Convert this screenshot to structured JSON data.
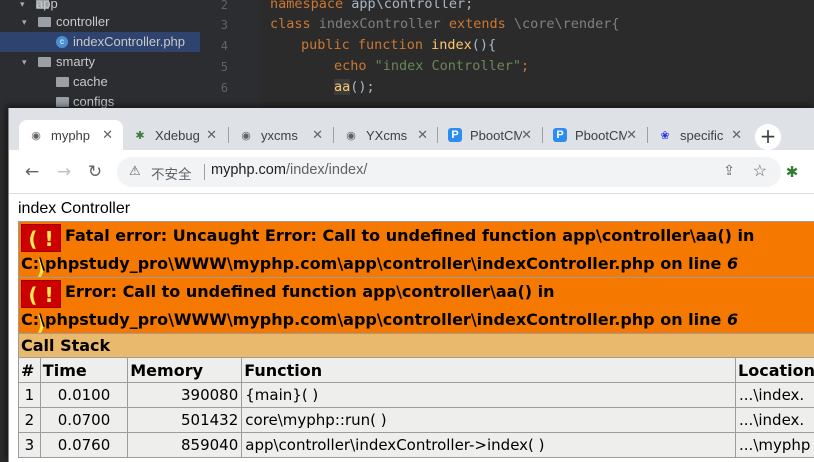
{
  "ide": {
    "tree": [
      {
        "label": "app",
        "kind": "folder",
        "indent": 1,
        "arrow": "▾"
      },
      {
        "label": "controller",
        "kind": "folder",
        "indent": 2,
        "arrow": "▾"
      },
      {
        "label": "indexController.php",
        "kind": "php",
        "indent": 3,
        "arrow": "",
        "selected": true
      },
      {
        "label": "smarty",
        "kind": "folder",
        "indent": 2,
        "arrow": "▾"
      },
      {
        "label": "cache",
        "kind": "folder",
        "indent": 3,
        "arrow": ""
      },
      {
        "label": "configs",
        "kind": "folder",
        "indent": 3,
        "arrow": ""
      }
    ],
    "line_numbers": [
      "2",
      "3",
      "4",
      "5",
      "6"
    ],
    "code": {
      "line2_kw": "namespace",
      "line2_rest": " app\\controller;",
      "line3_kw1": "class",
      "line3_name": " indexController ",
      "line3_kw2": "extends",
      "line3_rest": " \\core\\render{",
      "line4_kw1": "public",
      "line4_kw2": "function",
      "line4_fn": "index",
      "line4_rest": "(){",
      "line5_kw": "echo",
      "line5_str": "\"index Controller\"",
      "line5_end": ";",
      "line6_fn": "aa",
      "line6_rest": "();"
    }
  },
  "browser": {
    "tabs": [
      {
        "label": "myphp",
        "icon": "globe-icon",
        "glyph": "◉",
        "active": true
      },
      {
        "label": "Xdebug",
        "icon": "xdebug-icon",
        "glyph": "✱",
        "color": "#3a7d3a"
      },
      {
        "label": "yxcms",
        "icon": "globe-icon",
        "glyph": "◉"
      },
      {
        "label": "YXcms",
        "icon": "globe-icon",
        "glyph": "◉"
      },
      {
        "label": "PbootCMS",
        "icon": "pbootcms-icon",
        "glyph": "P",
        "color": "#2d8cf0"
      },
      {
        "label": "PbootCMS",
        "icon": "pbootcms-icon",
        "glyph": "P",
        "color": "#2d8cf0"
      },
      {
        "label": "specific",
        "icon": "baidu-paw-icon",
        "glyph": "❀",
        "color": "#2932e1"
      }
    ],
    "tab_close": "✕",
    "new_tab": "+",
    "omnibox": {
      "warning": "⚠",
      "insecure_label": "不安全",
      "host": "myphp.com",
      "path": "/index/index/"
    }
  },
  "page": {
    "echo": "index Controller",
    "errors": [
      {
        "badge": "( ! )",
        "line1": "Fatal error: Uncaught Error: Call to undefined function app\\controller\\aa() in",
        "line2": "C:\\phpstudy_pro\\WWW\\myphp.com\\app\\controller\\indexController.php on line ",
        "lineno": "6"
      },
      {
        "badge": "( ! )",
        "line1": "Error: Call to undefined function app\\controller\\aa() in",
        "line2": "C:\\phpstudy_pro\\WWW\\myphp.com\\app\\controller\\indexController.php on line ",
        "lineno": "6"
      }
    ],
    "call_stack": {
      "title": "Call Stack",
      "columns": [
        "#",
        "Time",
        "Memory",
        "Function",
        "Location"
      ],
      "rows": [
        [
          "1",
          "0.0100",
          "390080",
          "{main}( )",
          "...\\index."
        ],
        [
          "2",
          "0.0700",
          "501432",
          "core\\myphp::run( )",
          "...\\index."
        ],
        [
          "3",
          "0.0760",
          "859040",
          "app\\controller\\indexController->index( )",
          "...\\myphp"
        ]
      ]
    }
  }
}
